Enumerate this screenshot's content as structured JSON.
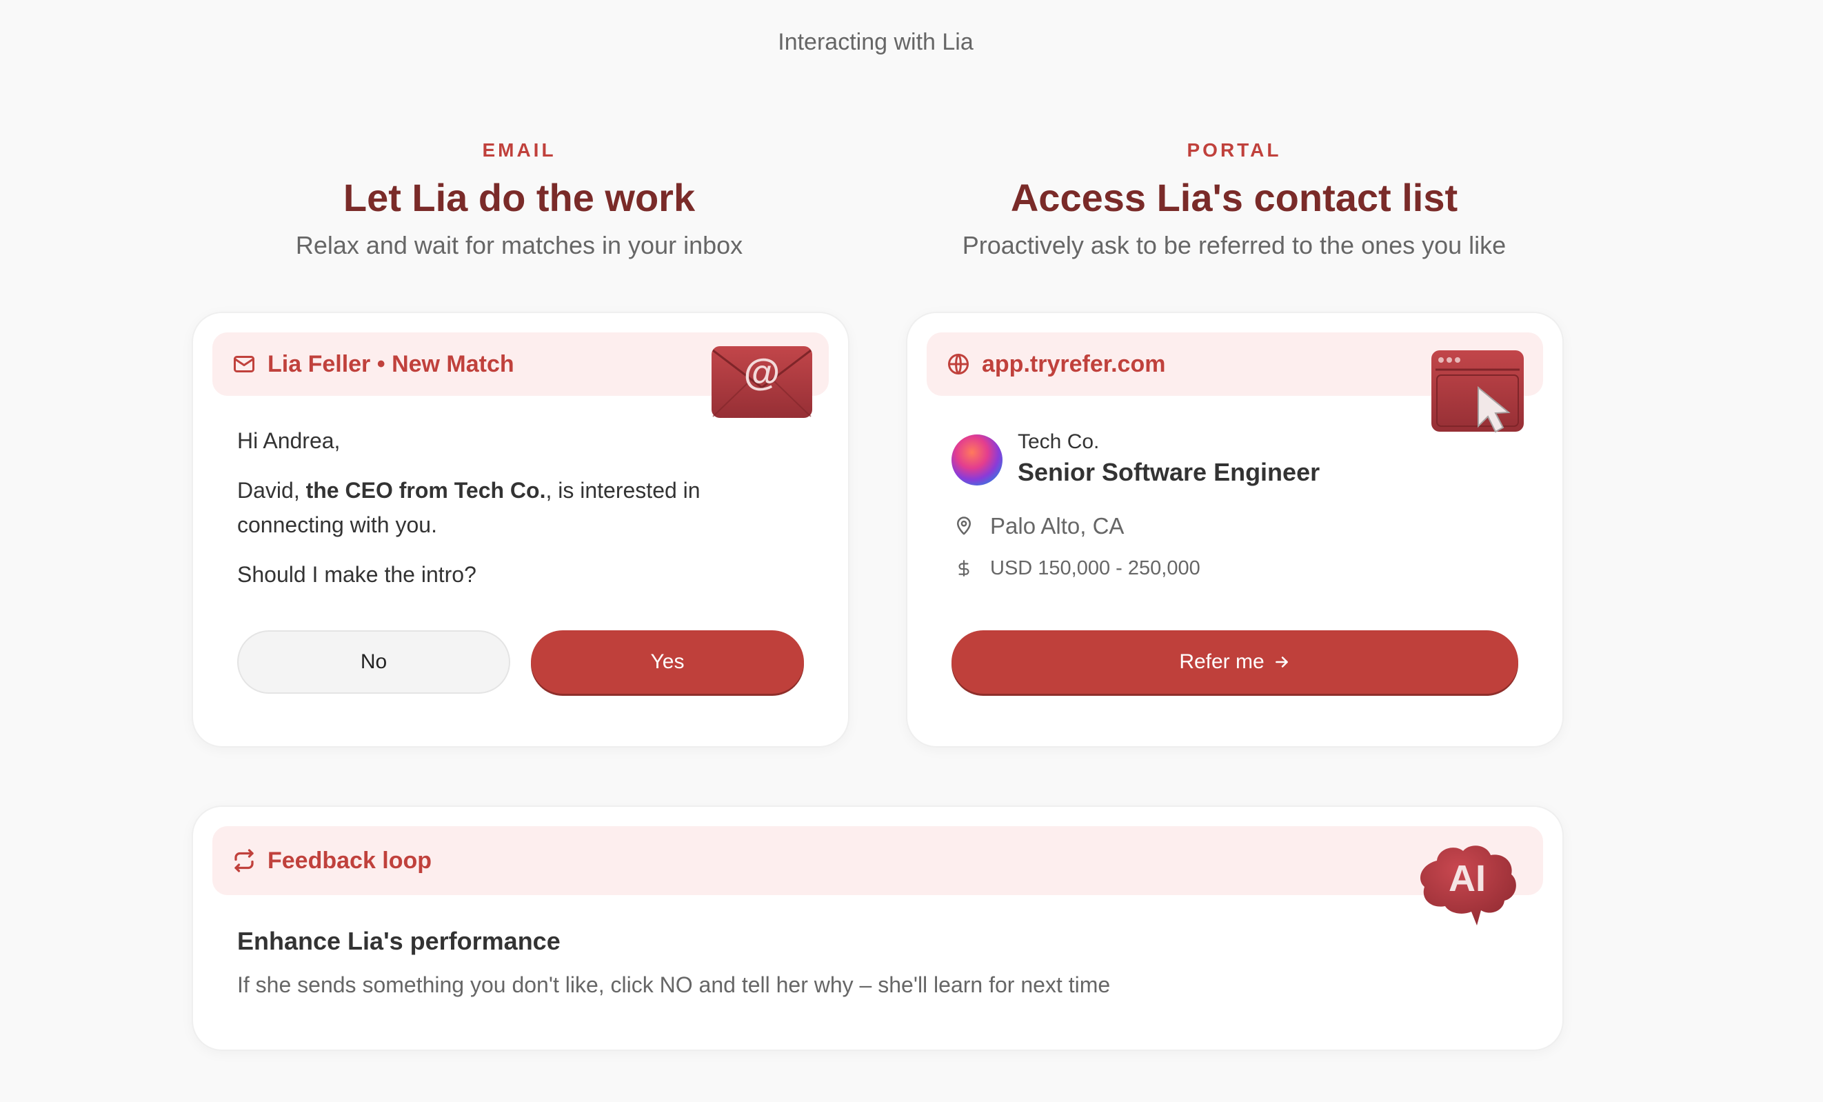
{
  "page": {
    "heading": "Interacting with Lia"
  },
  "email_section": {
    "eyebrow": "EMAIL",
    "title": "Let Lia do the work",
    "subtitle": "Relax and wait for matches in your inbox",
    "card": {
      "header": "Lia Feller • New Match",
      "header_icon": "mail-icon",
      "badge_icon": "envelope-at-3d-icon",
      "greeting": "Hi Andrea,",
      "message_pre": "David, ",
      "message_bold": "the CEO from Tech Co.",
      "message_post": ", is interested in connecting with you.",
      "question": "Should I make the intro?",
      "no_label": "No",
      "yes_label": "Yes"
    }
  },
  "portal_section": {
    "eyebrow": "PORTAL",
    "title": "Access Lia's contact list",
    "subtitle": "Proactively ask to be referred to the ones you like",
    "card": {
      "header": "app.tryrefer.com",
      "header_icon": "globe-icon",
      "badge_icon": "browser-cursor-3d-icon",
      "company": "Tech Co.",
      "job_title": "Senior Software Engineer",
      "location": "Palo Alto, CA",
      "salary": "USD 150,000 - 250,000",
      "refer_label": "Refer me"
    }
  },
  "feedback_section": {
    "header": "Feedback loop",
    "header_icon": "repeat-icon",
    "badge_icon": "ai-cloud-3d-icon",
    "badge_text": "AI",
    "title": "Enhance Lia's performance",
    "text": "If she sends something you don't like, click NO and tell her why – she'll learn for next time"
  },
  "colors": {
    "accent": "#bf403b",
    "title": "#7a2b29",
    "header_bg": "#fdeeee",
    "page_bg": "#f9f9f9"
  }
}
